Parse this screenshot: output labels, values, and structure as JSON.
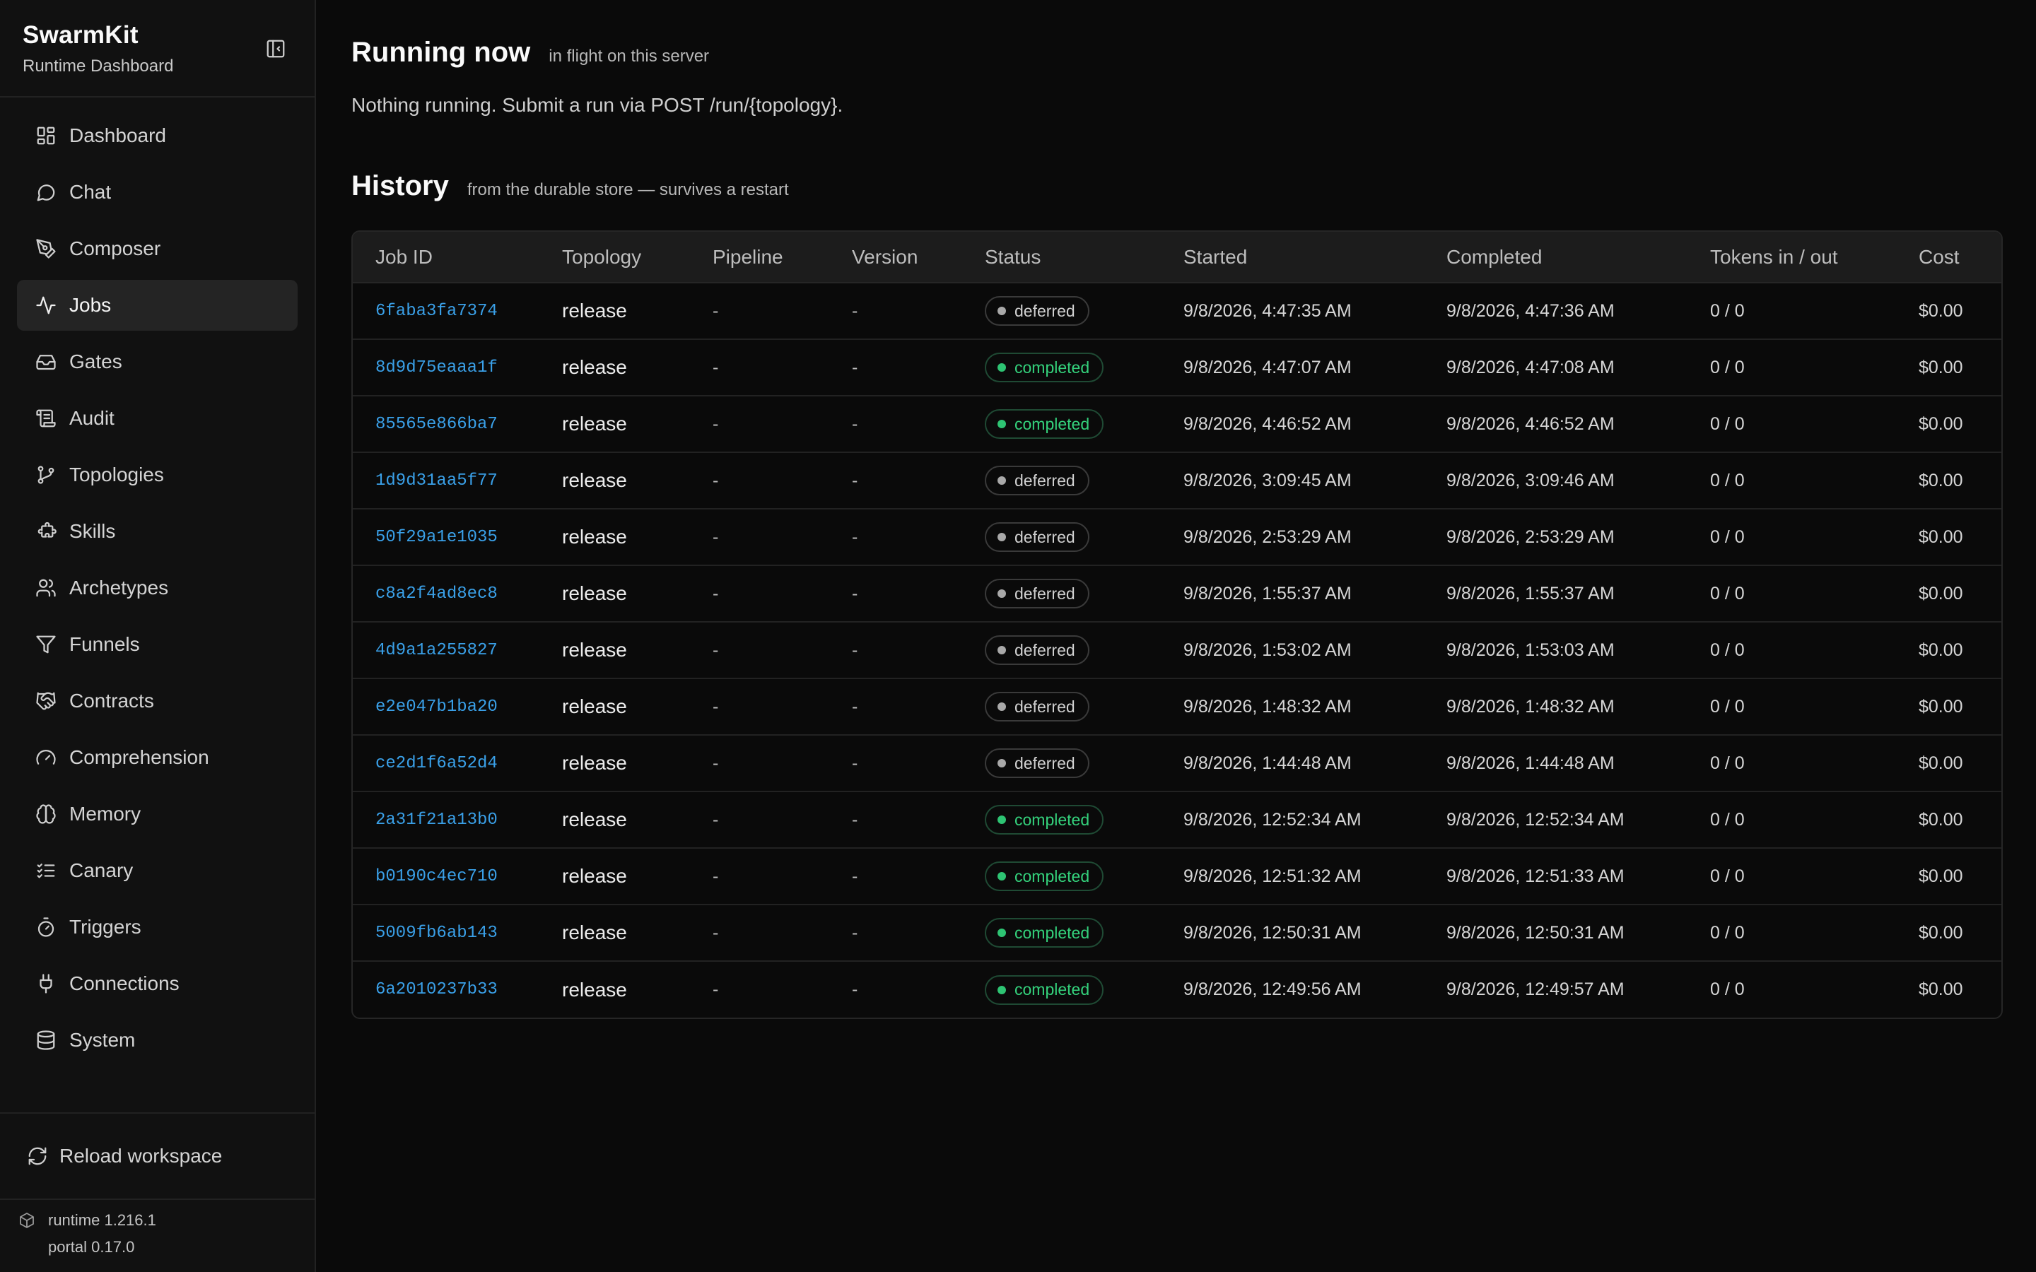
{
  "brand": {
    "title": "SwarmKit",
    "subtitle": "Runtime Dashboard"
  },
  "nav": [
    {
      "id": "dashboard",
      "label": "Dashboard",
      "icon": "grid-icon",
      "active": false
    },
    {
      "id": "chat",
      "label": "Chat",
      "icon": "chat-bubble-icon",
      "active": false
    },
    {
      "id": "composer",
      "label": "Composer",
      "icon": "pen-tool-icon",
      "active": false
    },
    {
      "id": "jobs",
      "label": "Jobs",
      "icon": "activity-icon",
      "active": true
    },
    {
      "id": "gates",
      "label": "Gates",
      "icon": "inbox-icon",
      "active": false
    },
    {
      "id": "audit",
      "label": "Audit",
      "icon": "scroll-icon",
      "active": false
    },
    {
      "id": "topologies",
      "label": "Topologies",
      "icon": "git-branch-icon",
      "active": false
    },
    {
      "id": "skills",
      "label": "Skills",
      "icon": "puzzle-icon",
      "active": false
    },
    {
      "id": "archetypes",
      "label": "Archetypes",
      "icon": "users-icon",
      "active": false
    },
    {
      "id": "funnels",
      "label": "Funnels",
      "icon": "filter-icon",
      "active": false
    },
    {
      "id": "contracts",
      "label": "Contracts",
      "icon": "handshake-icon",
      "active": false
    },
    {
      "id": "comprehension",
      "label": "Comprehension",
      "icon": "gauge-icon",
      "active": false
    },
    {
      "id": "memory",
      "label": "Memory",
      "icon": "brain-icon",
      "active": false
    },
    {
      "id": "canary",
      "label": "Canary",
      "icon": "checklist-icon",
      "active": false
    },
    {
      "id": "triggers",
      "label": "Triggers",
      "icon": "timer-icon",
      "active": false
    },
    {
      "id": "connections",
      "label": "Connections",
      "icon": "plug-icon",
      "active": false
    },
    {
      "id": "system",
      "label": "System",
      "icon": "database-icon",
      "active": false
    }
  ],
  "reload": {
    "label": "Reload workspace"
  },
  "versions": {
    "runtime": "runtime 1.216.1",
    "portal": "portal 0.17.0"
  },
  "running": {
    "title": "Running now",
    "subtitle": "in flight on this server",
    "empty": "Nothing running. Submit a run via POST /run/{topology}."
  },
  "history": {
    "title": "History",
    "subtitle": "from the durable store — survives a restart",
    "columns": [
      "Job ID",
      "Topology",
      "Pipeline",
      "Version",
      "Status",
      "Started",
      "Completed",
      "Tokens in / out",
      "Cost"
    ],
    "rows": [
      {
        "job": "6faba3fa7374",
        "topology": "release",
        "pipeline": "-",
        "version": "-",
        "status": "deferred",
        "started": "9/8/2026, 4:47:35 AM",
        "completed": "9/8/2026, 4:47:36 AM",
        "tokens": "0 / 0",
        "cost": "$0.00"
      },
      {
        "job": "8d9d75eaaa1f",
        "topology": "release",
        "pipeline": "-",
        "version": "-",
        "status": "completed",
        "started": "9/8/2026, 4:47:07 AM",
        "completed": "9/8/2026, 4:47:08 AM",
        "tokens": "0 / 0",
        "cost": "$0.00"
      },
      {
        "job": "85565e866ba7",
        "topology": "release",
        "pipeline": "-",
        "version": "-",
        "status": "completed",
        "started": "9/8/2026, 4:46:52 AM",
        "completed": "9/8/2026, 4:46:52 AM",
        "tokens": "0 / 0",
        "cost": "$0.00"
      },
      {
        "job": "1d9d31aa5f77",
        "topology": "release",
        "pipeline": "-",
        "version": "-",
        "status": "deferred",
        "started": "9/8/2026, 3:09:45 AM",
        "completed": "9/8/2026, 3:09:46 AM",
        "tokens": "0 / 0",
        "cost": "$0.00"
      },
      {
        "job": "50f29a1e1035",
        "topology": "release",
        "pipeline": "-",
        "version": "-",
        "status": "deferred",
        "started": "9/8/2026, 2:53:29 AM",
        "completed": "9/8/2026, 2:53:29 AM",
        "tokens": "0 / 0",
        "cost": "$0.00"
      },
      {
        "job": "c8a2f4ad8ec8",
        "topology": "release",
        "pipeline": "-",
        "version": "-",
        "status": "deferred",
        "started": "9/8/2026, 1:55:37 AM",
        "completed": "9/8/2026, 1:55:37 AM",
        "tokens": "0 / 0",
        "cost": "$0.00"
      },
      {
        "job": "4d9a1a255827",
        "topology": "release",
        "pipeline": "-",
        "version": "-",
        "status": "deferred",
        "started": "9/8/2026, 1:53:02 AM",
        "completed": "9/8/2026, 1:53:03 AM",
        "tokens": "0 / 0",
        "cost": "$0.00"
      },
      {
        "job": "e2e047b1ba20",
        "topology": "release",
        "pipeline": "-",
        "version": "-",
        "status": "deferred",
        "started": "9/8/2026, 1:48:32 AM",
        "completed": "9/8/2026, 1:48:32 AM",
        "tokens": "0 / 0",
        "cost": "$0.00"
      },
      {
        "job": "ce2d1f6a52d4",
        "topology": "release",
        "pipeline": "-",
        "version": "-",
        "status": "deferred",
        "started": "9/8/2026, 1:44:48 AM",
        "completed": "9/8/2026, 1:44:48 AM",
        "tokens": "0 / 0",
        "cost": "$0.00"
      },
      {
        "job": "2a31f21a13b0",
        "topology": "release",
        "pipeline": "-",
        "version": "-",
        "status": "completed",
        "started": "9/8/2026, 12:52:34 AM",
        "completed": "9/8/2026, 12:52:34 AM",
        "tokens": "0 / 0",
        "cost": "$0.00"
      },
      {
        "job": "b0190c4ec710",
        "topology": "release",
        "pipeline": "-",
        "version": "-",
        "status": "completed",
        "started": "9/8/2026, 12:51:32 AM",
        "completed": "9/8/2026, 12:51:33 AM",
        "tokens": "0 / 0",
        "cost": "$0.00"
      },
      {
        "job": "5009fb6ab143",
        "topology": "release",
        "pipeline": "-",
        "version": "-",
        "status": "completed",
        "started": "9/8/2026, 12:50:31 AM",
        "completed": "9/8/2026, 12:50:31 AM",
        "tokens": "0 / 0",
        "cost": "$0.00"
      },
      {
        "job": "6a2010237b33",
        "topology": "release",
        "pipeline": "-",
        "version": "-",
        "status": "completed",
        "started": "9/8/2026, 12:49:56 AM",
        "completed": "9/8/2026, 12:49:57 AM",
        "tokens": "0 / 0",
        "cost": "$0.00"
      }
    ]
  },
  "colors": {
    "accent_link": "#3aa0e8",
    "completed": "#34d27c",
    "deferred": "#a9a9a9",
    "background": "#0a0a0a",
    "sidebar": "#111111"
  }
}
